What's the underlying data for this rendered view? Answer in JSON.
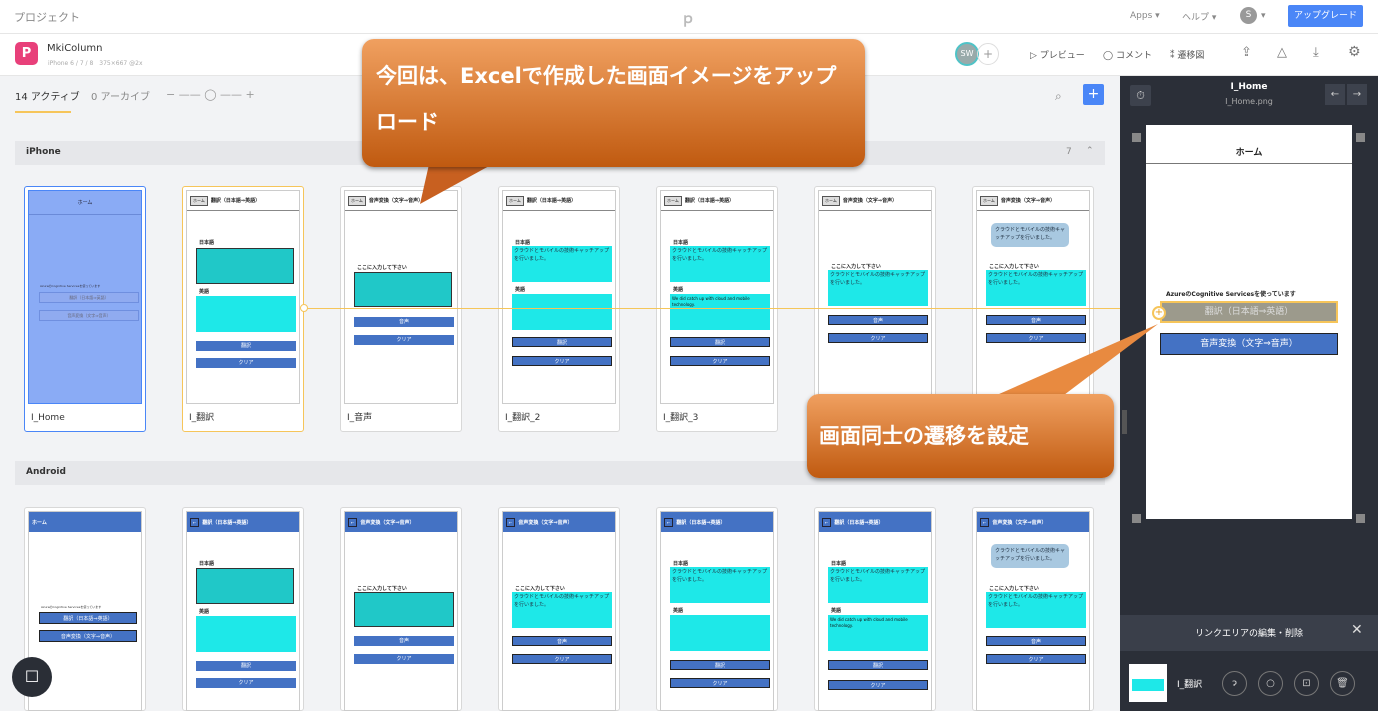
{
  "topbar": {
    "project_label": "プロジェクト",
    "apps": "Apps",
    "help": "ヘルプ",
    "avatar": "S",
    "upgrade": "アップグレード"
  },
  "project": {
    "name": "MkiColumn",
    "meta": "iPhone 6 / 7 / 8　375×667 @2x",
    "collab": "SW",
    "preview": "プレビュー",
    "comment": "コメント",
    "transition": "遷移図"
  },
  "tabs": {
    "active": "14 アクティブ",
    "archive": "0 アーカイブ"
  },
  "sections": {
    "iphone": "iPhone",
    "iphone_count": "7",
    "android": "Android"
  },
  "screens": {
    "home_title": "ホーム",
    "home_sub": "AzureのCognitive Servicesを使っています",
    "home_btn1": "翻訳（日本語⇒英語）",
    "home_btn2": "音声変換（文字⇒音声）",
    "home_hb": "ホーム",
    "hdr_translate": "翻訳（日本語⇒英語）",
    "hdr_voice": "音声変換（文字⇒音声）",
    "lbl_ja": "日本語",
    "lbl_en": "英語",
    "btn_translate": "翻訳",
    "btn_clear": "クリア",
    "btn_voice": "音声",
    "input_prompt": "ここに入力して下さい",
    "ja_text": "クラウドとモバイルの技術キャッチアップを行いました。",
    "en_text": "We did catch up with cloud and mobile technology.",
    "bubble_text": "クラウドとモバイルの技術キャッチアップを行いました。",
    "android_bubble": "クラウドとモバイルの技術キャッチアップを行いました。",
    "captions": [
      "I_Home",
      "I_翻訳",
      "I_音声",
      "I_翻訳_2",
      "I_翻訳_3"
    ]
  },
  "callouts": {
    "upload": "今回は、Excelで作成した画面イメージをアップロード",
    "link": "画面同士の遷移を設定"
  },
  "right": {
    "title": "I_Home",
    "file": "I_Home.png",
    "screen_title": "ホーム",
    "sub": "AzureのCognitive Servicesを使っています",
    "btn1": "翻訳（日本語⇒英語）",
    "btn2": "音声変換（文字⇒音声）",
    "link_panel": "リンクエリアの編集・削除",
    "link_target": "I_翻訳"
  },
  "colors": {
    "accent": "#4a86f7",
    "brand": "#e8407a",
    "highlight": "#f6c55a"
  }
}
